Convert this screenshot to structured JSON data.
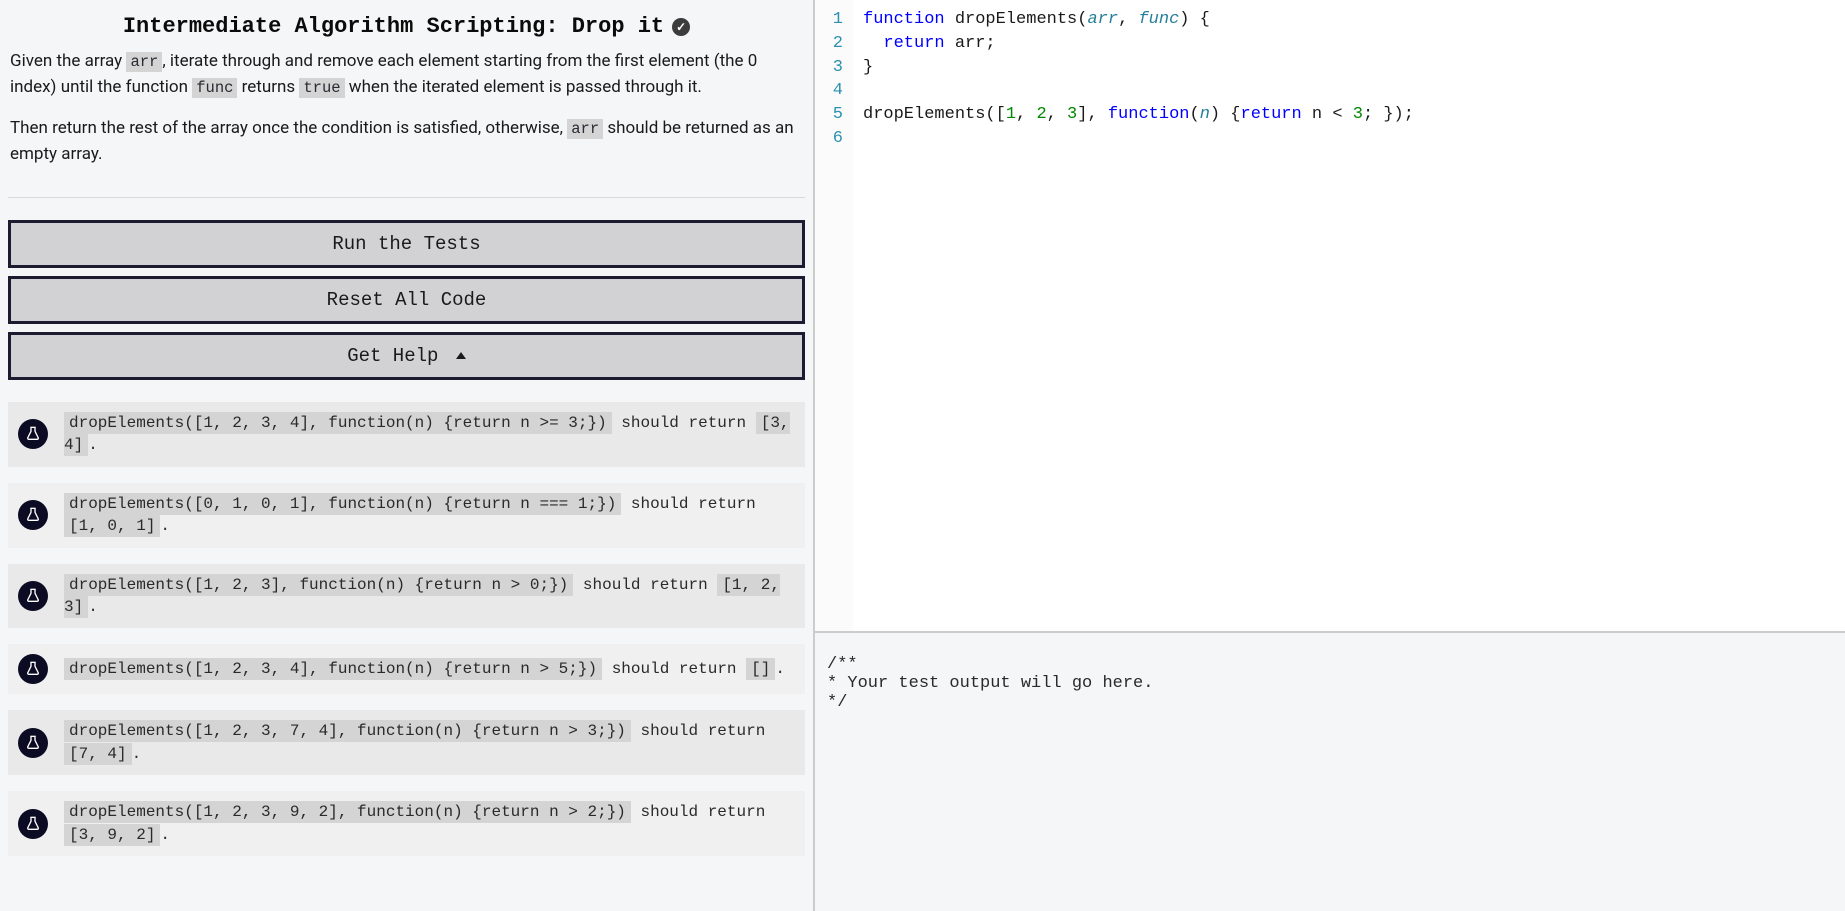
{
  "title": "Intermediate Algorithm Scripting: Drop it",
  "description": {
    "p1_a": "Given the array ",
    "p1_c1": "arr",
    "p1_b": ", iterate through and remove each element starting from the first element (the 0 index) until the function ",
    "p1_c2": "func",
    "p1_c": " returns ",
    "p1_c3": "true",
    "p1_d": " when the iterated element is passed through it.",
    "p2_a": "Then return the rest of the array once the condition is satisfied, otherwise, ",
    "p2_c1": "arr",
    "p2_b": " should be returned as an empty array."
  },
  "buttons": {
    "run": "Run the Tests",
    "reset": "Reset All Code",
    "help": "Get Help"
  },
  "tests": [
    {
      "call": "dropElements([1, 2, 3, 4], function(n) {return n >= 3;})",
      "mid": " should return ",
      "ret": "[3, 4]",
      "tail": "."
    },
    {
      "call": "dropElements([0, 1, 0, 1], function(n) {return n === 1;})",
      "mid": " should return ",
      "ret": "[1, 0, 1]",
      "tail": "."
    },
    {
      "call": "dropElements([1, 2, 3], function(n) {return n > 0;})",
      "mid": " should return ",
      "ret": "[1, 2, 3]",
      "tail": "."
    },
    {
      "call": "dropElements([1, 2, 3, 4], function(n) {return n > 5;})",
      "mid": " should return ",
      "ret": "[]",
      "tail": "."
    },
    {
      "call": "dropElements([1, 2, 3, 7, 4], function(n) {return n > 3;})",
      "mid": " should return ",
      "ret": "[7, 4]",
      "tail": "."
    },
    {
      "call": "dropElements([1, 2, 3, 9, 2], function(n) {return n > 2;})",
      "mid": " should return ",
      "ret": "[3, 9, 2]",
      "tail": "."
    }
  ],
  "editor": {
    "line_numbers": [
      "1",
      "2",
      "3",
      "4",
      "5",
      "6"
    ]
  },
  "console_output": "/**\n* Your test output will go here.\n*/"
}
